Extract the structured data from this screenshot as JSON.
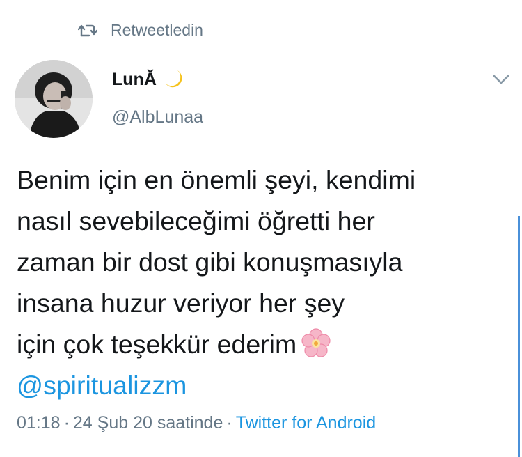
{
  "retweet": {
    "label": "Retweetledin",
    "icon": "retweet-icon"
  },
  "author": {
    "display_name": "LunĂ",
    "name_emoji": "crescent-moon-icon",
    "handle": "@AlbLunaa",
    "avatar": "avatar-photo"
  },
  "tweet": {
    "lines": [
      "Benim için en önemli şeyi, kendimi",
      "nasıl sevebileceğimi öğretti her",
      "zaman bir dost gibi konuşmasıyla",
      "insana huzur veriyor her şey",
      "için çok teşekkür ederim"
    ],
    "trailing_emoji": "cherry-blossom-icon",
    "mention": "@spiritualizzm"
  },
  "meta": {
    "time": "01:18",
    "separator1": "·",
    "date": "24 Şub 20 saatinde",
    "separator2": "·",
    "source": "Twitter for Android"
  },
  "colors": {
    "text": "#14171a",
    "secondary": "#657786",
    "link": "#1b95e0"
  }
}
